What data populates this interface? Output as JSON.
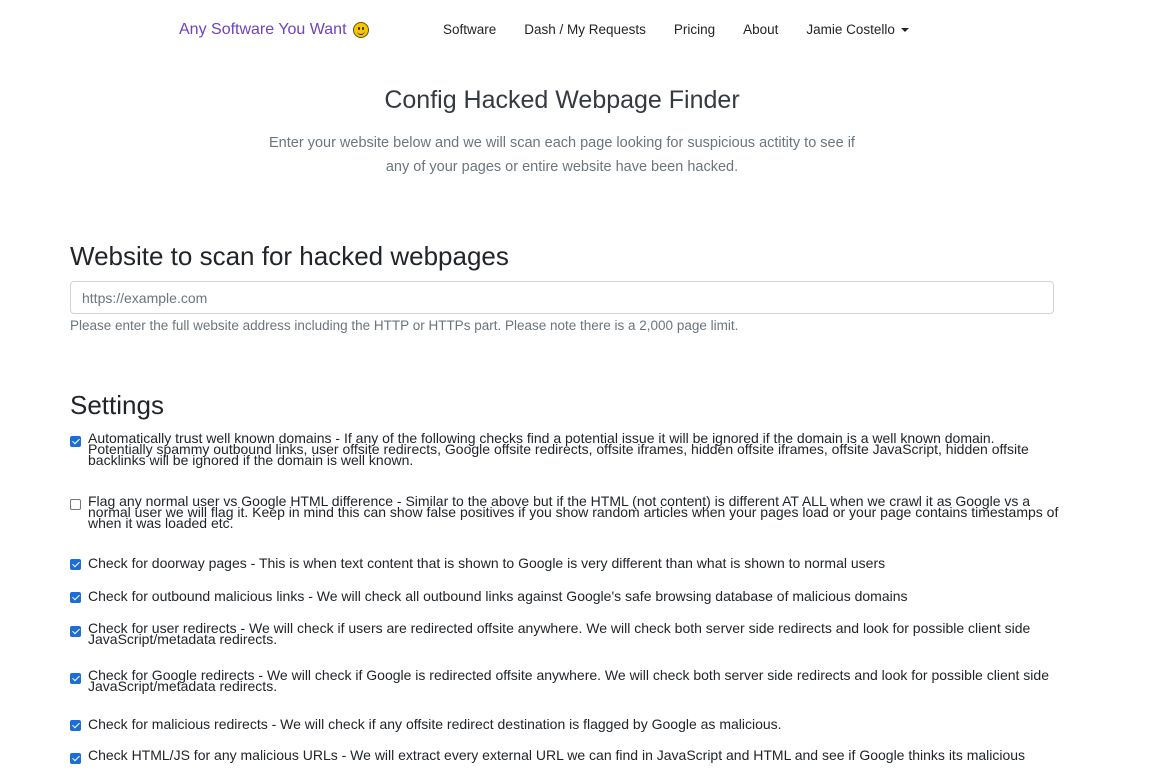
{
  "nav": {
    "brand": "Any Software You Want",
    "links": [
      "Software",
      "Dash / My Requests",
      "Pricing",
      "About"
    ],
    "user": "Jamie Costello"
  },
  "hero": {
    "title": "Config Hacked Webpage Finder",
    "subtitle": "Enter your website below and we will scan each page looking for suspicious actitity to see if any of your pages or entire website have been hacked."
  },
  "website": {
    "heading": "Website to scan for hacked webpages",
    "placeholder": "https://example.com",
    "help": "Please enter the full website address including the HTTP or HTTPs part. Please note there is a 2,000 page limit."
  },
  "settings": {
    "heading": "Settings",
    "options": [
      {
        "checked": true,
        "text": "Automatically trust well known domains - If any of the following checks find a potential issue it will be ignored if the domain is a well known domain. Potentially spammy outbound links, user offsite redirects, Google offsite redirects, offsite iframes, hidden offsite iframes, offsite JavaScript, hidden offsite backlinks will be ignored if the domain is well known."
      },
      {
        "checked": false,
        "text": "Flag any normal user vs Google HTML difference - Similar to the above but if the HTML (not content) is different AT ALL when we crawl it as Google vs a normal user we will flag it. Keep in mind this can show false positives if you show random articles when your pages load or your page contains timestamps of when it was loaded etc."
      },
      {
        "checked": true,
        "text": "Check for doorway pages - This is when text content that is shown to Google is very different than what is shown to normal users"
      },
      {
        "checked": true,
        "text": "Check for outbound malicious links - We will check all outbound links against Google's safe browsing database of malicious domains"
      },
      {
        "checked": true,
        "text": "Check for user redirects - We will check if users are redirected offsite anywhere. We will check both server side redirects and look for possible client side JavaScript/metadata redirects."
      },
      {
        "checked": true,
        "text": "Check for Google redirects - We will check if Google is redirected offsite anywhere. We will check both server side redirects and look for possible client side JavaScript/metadata redirects."
      },
      {
        "checked": true,
        "text": "Check for malicious redirects - We will check if any offsite redirect destination is flagged by Google as malicious."
      },
      {
        "checked": true,
        "text": "Check HTML/JS for any malicious URLs - We will extract every external URL we can find in JavaScript and HTML and see if Google thinks its malicious"
      }
    ]
  },
  "colors": {
    "brand": "#6f42c1",
    "checkbox": "#1a6ed8"
  }
}
